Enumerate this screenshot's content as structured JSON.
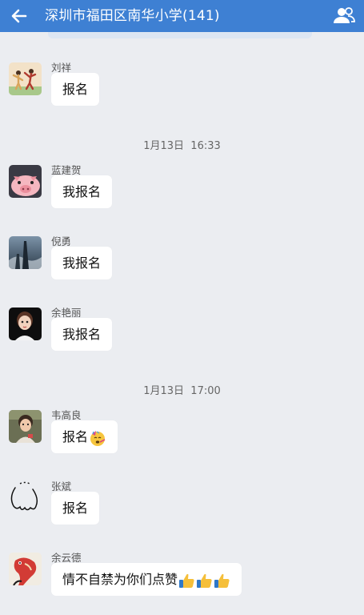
{
  "header": {
    "title": "深圳市福田区南华小学(141)",
    "back_icon": "back-arrow-icon",
    "members_icon": "group-members-icon",
    "bar_color": "#3e80d3"
  },
  "timestamps": [
    "1月13日  16:33",
    "1月13日  17:00"
  ],
  "messages": [
    {
      "sender": "刘祥",
      "text": "报名"
    },
    {
      "sender": "蓝建贺",
      "text": "我报名"
    },
    {
      "sender": "倪勇",
      "text": "我报名"
    },
    {
      "sender": "余艳丽",
      "text": "我报名"
    },
    {
      "sender": "韦高良",
      "text": "报名",
      "emoji": "party-face-emoji"
    },
    {
      "sender": "张斌",
      "text": "报名"
    },
    {
      "sender": "余云德",
      "text": "情不自禁为你们点赞",
      "emoji": "thumbs-up-emoji-x3"
    }
  ]
}
